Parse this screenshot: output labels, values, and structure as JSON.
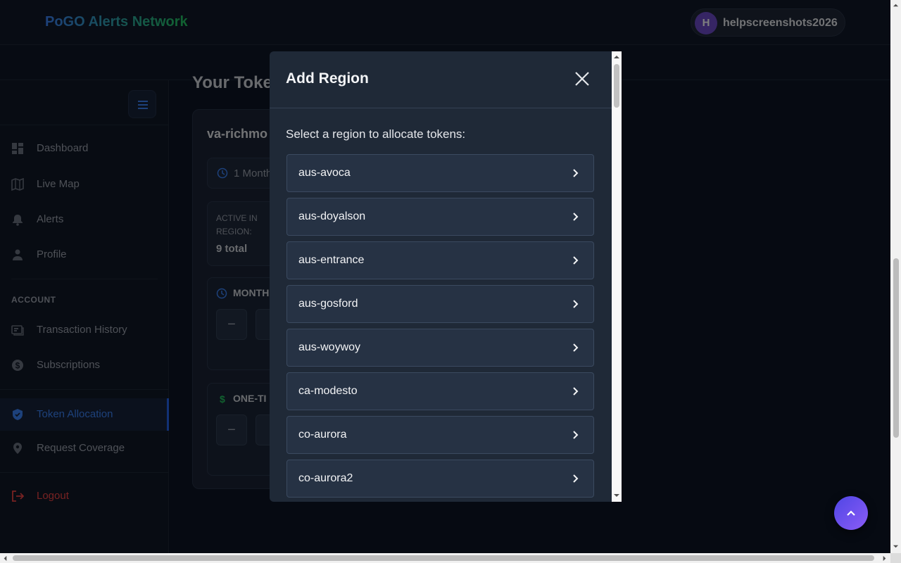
{
  "header": {
    "brand": "PoGO Alerts Network",
    "avatar_initial": "H",
    "username": "helpscreenshots2026"
  },
  "sidebar": {
    "items": [
      {
        "label": "Dashboard",
        "icon": "dashboard-icon"
      },
      {
        "label": "Live Map",
        "icon": "map-icon"
      },
      {
        "label": "Alerts",
        "icon": "bell-icon"
      },
      {
        "label": "Profile",
        "icon": "person-icon"
      }
    ],
    "account_section": "ACCOUNT",
    "account_items": [
      {
        "label": "Transaction History",
        "icon": "receipt-icon"
      },
      {
        "label": "Subscriptions",
        "icon": "dollar-icon"
      }
    ],
    "extra_items": [
      {
        "label": "Token Allocation",
        "icon": "shield-icon",
        "active": true
      },
      {
        "label": "Request Coverage",
        "icon": "location-pin-icon"
      }
    ],
    "logout": "Logout"
  },
  "main": {
    "title": "Your Toke",
    "card": {
      "region": "va-richmo",
      "plan": "1 Month",
      "stat_label": "ACTIVE IN REGION:",
      "stat_value": "9 total",
      "monthly_title": "MONTH",
      "onetime_title": "ONE-TI",
      "stepper_minus": "−"
    }
  },
  "modal": {
    "title": "Add Region",
    "prompt": "Select a region to allocate tokens:",
    "regions": [
      "aus-avoca",
      "aus-doyalson",
      "aus-entrance",
      "aus-gosford",
      "aus-woywoy",
      "ca-modesto",
      "co-aurora",
      "co-aurora2"
    ]
  },
  "colors": {
    "accent": "#3b82f6",
    "active_nav": "#2563eb",
    "danger": "#ef4444",
    "modal_bg": "#1f2937",
    "list_item_bg": "#263244"
  }
}
